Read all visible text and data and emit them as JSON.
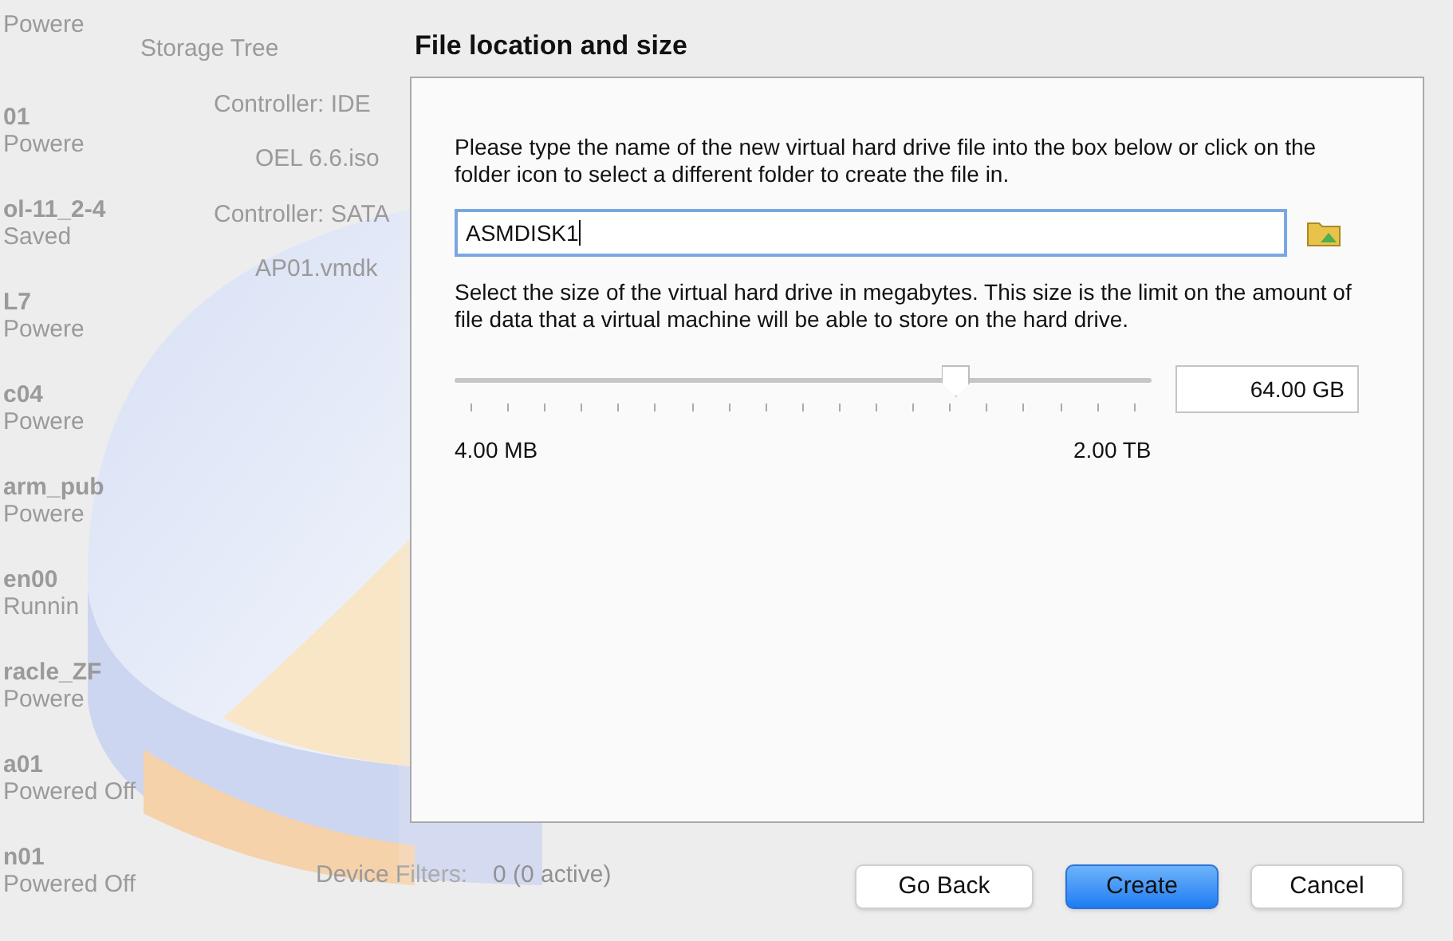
{
  "background": {
    "machines": [
      {
        "status": "Powere"
      },
      {
        "name": "01",
        "status": "Powere"
      },
      {
        "name": "ol-11_2-4",
        "status": "Saved"
      },
      {
        "name": "L7",
        "status": "Powere"
      },
      {
        "name": "c04",
        "status": "Powere"
      },
      {
        "name": "arm_pub",
        "status": "Powere"
      },
      {
        "name": "en00",
        "status": "Runnin"
      },
      {
        "name": "racle_ZF",
        "status": "Powere"
      },
      {
        "name": "a01",
        "status": "Powered Off"
      },
      {
        "name": "n01",
        "status": "Powered Off"
      }
    ],
    "storage_tree": {
      "title": "Storage Tree",
      "items": [
        {
          "label": "Controller: IDE",
          "children": [
            {
              "label": "OEL 6.6.iso"
            }
          ]
        },
        {
          "label": "Controller: SATA",
          "children": [
            {
              "label": "AP01.vmdk"
            }
          ]
        }
      ]
    },
    "device_filters_label": "Device Filters:",
    "device_filters_value": "0 (0 active)"
  },
  "dialog": {
    "title": "File location and size",
    "location_text": "Please type the name of the new virtual hard drive file into the box below or click on the folder icon to select a different folder to create the file in.",
    "file_name": "ASMDISK1",
    "size_text": "Select the size of the virtual hard drive in megabytes. This size is the limit on the amount of file data that a virtual machine will be able to store on the hard drive.",
    "size_slider": {
      "level": 0.72,
      "min_label": "4.00 MB",
      "max_label": "2.00 TB"
    },
    "size_value": "64.00 GB",
    "buttons": [
      {
        "label": "Go Back",
        "default": false
      },
      {
        "label": "Create",
        "default": true
      },
      {
        "label": "Cancel",
        "default": false
      }
    ]
  }
}
